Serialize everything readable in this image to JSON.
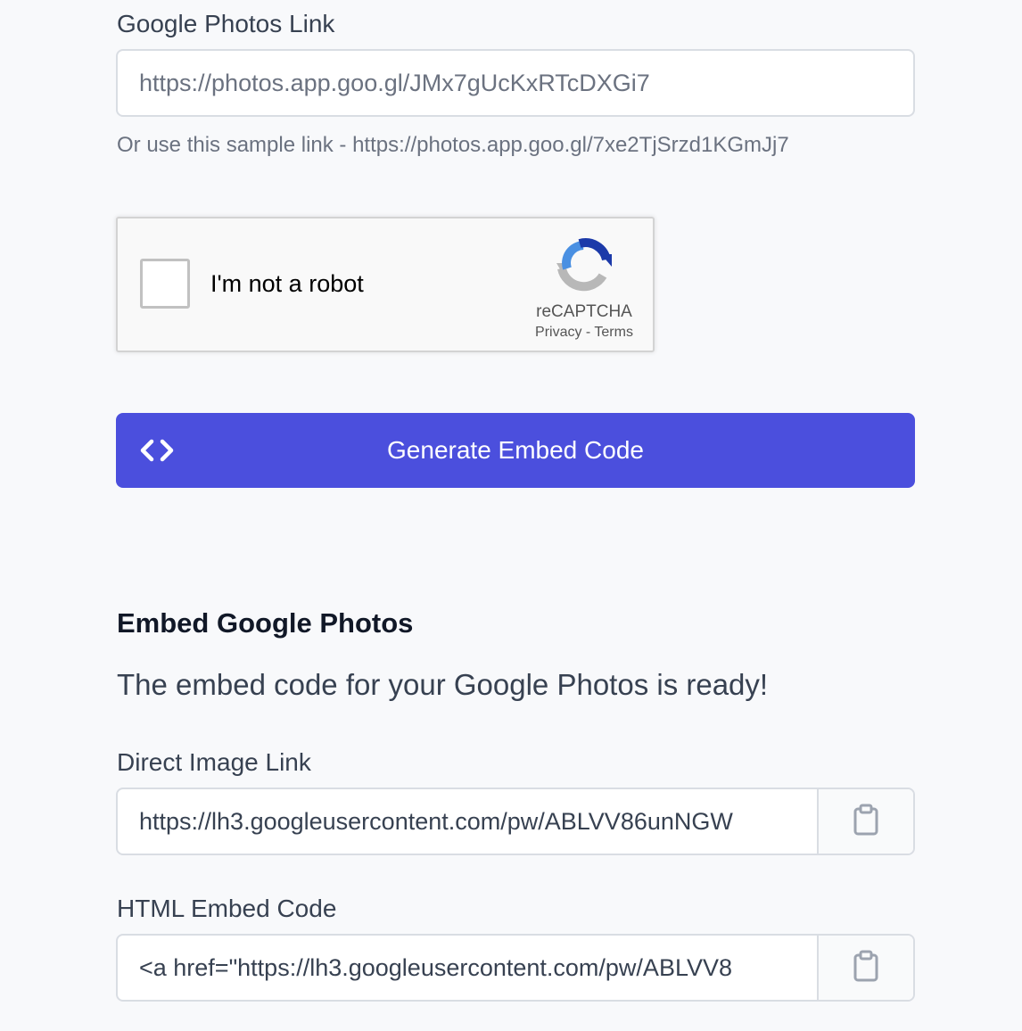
{
  "form": {
    "link_label": "Google Photos Link",
    "link_value": "https://photos.app.goo.gl/JMx7gUcKxRTcDXGi7",
    "sample_text": "Or use this sample link - https://photos.app.goo.gl/7xe2TjSrzd1KGmJj7"
  },
  "recaptcha": {
    "label": "I'm not a robot",
    "brand": "reCAPTCHA",
    "privacy": "Privacy",
    "separator": " - ",
    "terms": "Terms"
  },
  "generate_button": {
    "label": "Generate Embed Code",
    "icon": "code-icon",
    "color": "#4b4fdd"
  },
  "result": {
    "heading": "Embed Google Photos",
    "ready_text": "The embed code for your Google Photos is ready!",
    "direct_link_label": "Direct Image Link",
    "direct_link_value": "https://lh3.googleusercontent.com/pw/ABLVV86unNGW",
    "html_code_label": "HTML Embed Code",
    "html_code_value": "<a href=\"https://lh3.googleusercontent.com/pw/ABLVV8",
    "copy_icon": "clipboard-icon"
  }
}
